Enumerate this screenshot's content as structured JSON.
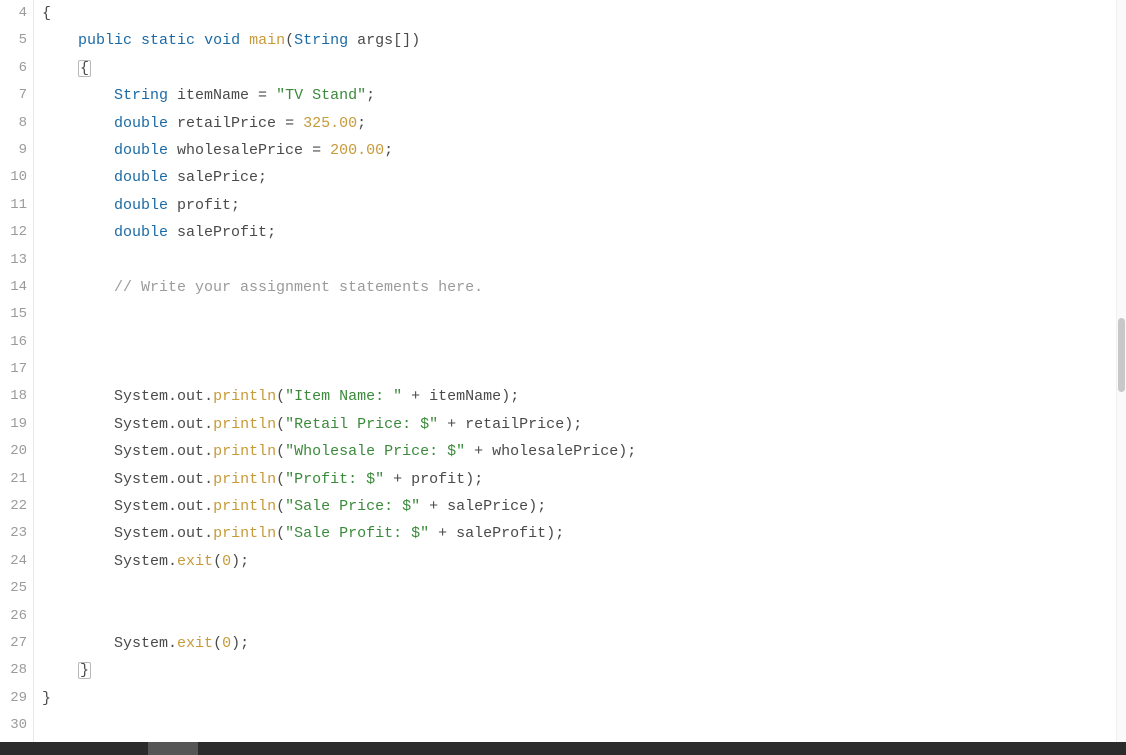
{
  "editor": {
    "first_line_number": 4,
    "line_count": 27,
    "lines": {
      "l4": [
        {
          "c": "tok-punct",
          "t": "{"
        }
      ],
      "l5": [
        {
          "c": "tok-ident",
          "t": "    "
        },
        {
          "c": "tok-keyword",
          "t": "public"
        },
        {
          "c": "tok-ident",
          "t": " "
        },
        {
          "c": "tok-keyword",
          "t": "static"
        },
        {
          "c": "tok-ident",
          "t": " "
        },
        {
          "c": "tok-keyword",
          "t": "void"
        },
        {
          "c": "tok-ident",
          "t": " "
        },
        {
          "c": "tok-func",
          "t": "main"
        },
        {
          "c": "tok-paren",
          "t": "("
        },
        {
          "c": "tok-class",
          "t": "String"
        },
        {
          "c": "tok-ident",
          "t": " args"
        },
        {
          "c": "tok-punct",
          "t": "[]"
        },
        {
          "c": "tok-paren",
          "t": ")"
        }
      ],
      "l6": [
        {
          "c": "tok-ident",
          "t": "    "
        },
        {
          "c": "tok-punct brace-hi",
          "t": "{"
        }
      ],
      "l7": [
        {
          "c": "tok-ident",
          "t": "        "
        },
        {
          "c": "tok-class",
          "t": "String"
        },
        {
          "c": "tok-ident",
          "t": " itemName "
        },
        {
          "c": "tok-op",
          "t": "="
        },
        {
          "c": "tok-ident",
          "t": " "
        },
        {
          "c": "tok-string",
          "t": "\"TV Stand\""
        },
        {
          "c": "tok-punct",
          "t": ";"
        }
      ],
      "l8": [
        {
          "c": "tok-ident",
          "t": "        "
        },
        {
          "c": "tok-keyword",
          "t": "double"
        },
        {
          "c": "tok-ident",
          "t": " retailPrice "
        },
        {
          "c": "tok-op",
          "t": "="
        },
        {
          "c": "tok-ident",
          "t": " "
        },
        {
          "c": "tok-number",
          "t": "325.00"
        },
        {
          "c": "tok-punct",
          "t": ";"
        }
      ],
      "l9": [
        {
          "c": "tok-ident",
          "t": "        "
        },
        {
          "c": "tok-keyword",
          "t": "double"
        },
        {
          "c": "tok-ident",
          "t": " wholesalePrice "
        },
        {
          "c": "tok-op",
          "t": "="
        },
        {
          "c": "tok-ident",
          "t": " "
        },
        {
          "c": "tok-number",
          "t": "200.00"
        },
        {
          "c": "tok-punct",
          "t": ";"
        }
      ],
      "l10": [
        {
          "c": "tok-ident",
          "t": "        "
        },
        {
          "c": "tok-keyword",
          "t": "double"
        },
        {
          "c": "tok-ident",
          "t": " salePrice"
        },
        {
          "c": "tok-punct",
          "t": ";"
        }
      ],
      "l11": [
        {
          "c": "tok-ident",
          "t": "        "
        },
        {
          "c": "tok-keyword",
          "t": "double"
        },
        {
          "c": "tok-ident",
          "t": " profit"
        },
        {
          "c": "tok-punct",
          "t": ";"
        }
      ],
      "l12": [
        {
          "c": "tok-ident",
          "t": "        "
        },
        {
          "c": "tok-keyword",
          "t": "double"
        },
        {
          "c": "tok-ident",
          "t": " saleProfit"
        },
        {
          "c": "tok-punct",
          "t": ";"
        }
      ],
      "l13": [
        {
          "c": "tok-ident",
          "t": ""
        }
      ],
      "l14": [
        {
          "c": "tok-ident",
          "t": "        "
        },
        {
          "c": "tok-comment",
          "t": "// Write your assignment statements here."
        }
      ],
      "l15": [
        {
          "c": "tok-ident",
          "t": ""
        }
      ],
      "l16": [
        {
          "c": "tok-ident",
          "t": ""
        }
      ],
      "l17": [
        {
          "c": "tok-ident",
          "t": ""
        }
      ],
      "l18": [
        {
          "c": "tok-ident",
          "t": "        System"
        },
        {
          "c": "tok-punct",
          "t": "."
        },
        {
          "c": "tok-ident",
          "t": "out"
        },
        {
          "c": "tok-punct",
          "t": "."
        },
        {
          "c": "tok-func",
          "t": "println"
        },
        {
          "c": "tok-paren",
          "t": "("
        },
        {
          "c": "tok-string",
          "t": "\"Item Name: \""
        },
        {
          "c": "tok-ident",
          "t": " "
        },
        {
          "c": "tok-op",
          "t": "+"
        },
        {
          "c": "tok-ident",
          "t": " itemName"
        },
        {
          "c": "tok-paren",
          "t": ")"
        },
        {
          "c": "tok-punct",
          "t": ";"
        }
      ],
      "l19": [
        {
          "c": "tok-ident",
          "t": "        System"
        },
        {
          "c": "tok-punct",
          "t": "."
        },
        {
          "c": "tok-ident",
          "t": "out"
        },
        {
          "c": "tok-punct",
          "t": "."
        },
        {
          "c": "tok-func",
          "t": "println"
        },
        {
          "c": "tok-paren",
          "t": "("
        },
        {
          "c": "tok-string",
          "t": "\"Retail Price: $\""
        },
        {
          "c": "tok-ident",
          "t": " "
        },
        {
          "c": "tok-op",
          "t": "+"
        },
        {
          "c": "tok-ident",
          "t": " retailPrice"
        },
        {
          "c": "tok-paren",
          "t": ")"
        },
        {
          "c": "tok-punct",
          "t": ";"
        }
      ],
      "l20": [
        {
          "c": "tok-ident",
          "t": "        System"
        },
        {
          "c": "tok-punct",
          "t": "."
        },
        {
          "c": "tok-ident",
          "t": "out"
        },
        {
          "c": "tok-punct",
          "t": "."
        },
        {
          "c": "tok-func",
          "t": "println"
        },
        {
          "c": "tok-paren",
          "t": "("
        },
        {
          "c": "tok-string",
          "t": "\"Wholesale Price: $\""
        },
        {
          "c": "tok-ident",
          "t": " "
        },
        {
          "c": "tok-op",
          "t": "+"
        },
        {
          "c": "tok-ident",
          "t": " wholesalePrice"
        },
        {
          "c": "tok-paren",
          "t": ")"
        },
        {
          "c": "tok-punct",
          "t": ";"
        }
      ],
      "l21": [
        {
          "c": "tok-ident",
          "t": "        System"
        },
        {
          "c": "tok-punct",
          "t": "."
        },
        {
          "c": "tok-ident",
          "t": "out"
        },
        {
          "c": "tok-punct",
          "t": "."
        },
        {
          "c": "tok-func",
          "t": "println"
        },
        {
          "c": "tok-paren",
          "t": "("
        },
        {
          "c": "tok-string",
          "t": "\"Profit: $\""
        },
        {
          "c": "tok-ident",
          "t": " "
        },
        {
          "c": "tok-op",
          "t": "+"
        },
        {
          "c": "tok-ident",
          "t": " profit"
        },
        {
          "c": "tok-paren",
          "t": ")"
        },
        {
          "c": "tok-punct",
          "t": ";"
        }
      ],
      "l22": [
        {
          "c": "tok-ident",
          "t": "        System"
        },
        {
          "c": "tok-punct",
          "t": "."
        },
        {
          "c": "tok-ident",
          "t": "out"
        },
        {
          "c": "tok-punct",
          "t": "."
        },
        {
          "c": "tok-func",
          "t": "println"
        },
        {
          "c": "tok-paren",
          "t": "("
        },
        {
          "c": "tok-string",
          "t": "\"Sale Price: $\""
        },
        {
          "c": "tok-ident",
          "t": " "
        },
        {
          "c": "tok-op",
          "t": "+"
        },
        {
          "c": "tok-ident",
          "t": " salePrice"
        },
        {
          "c": "tok-paren",
          "t": ")"
        },
        {
          "c": "tok-punct",
          "t": ";"
        }
      ],
      "l23": [
        {
          "c": "tok-ident",
          "t": "        System"
        },
        {
          "c": "tok-punct",
          "t": "."
        },
        {
          "c": "tok-ident",
          "t": "out"
        },
        {
          "c": "tok-punct",
          "t": "."
        },
        {
          "c": "tok-func",
          "t": "println"
        },
        {
          "c": "tok-paren",
          "t": "("
        },
        {
          "c": "tok-string",
          "t": "\"Sale Profit: $\""
        },
        {
          "c": "tok-ident",
          "t": " "
        },
        {
          "c": "tok-op",
          "t": "+"
        },
        {
          "c": "tok-ident",
          "t": " saleProfit"
        },
        {
          "c": "tok-paren",
          "t": ")"
        },
        {
          "c": "tok-punct",
          "t": ";"
        }
      ],
      "l24": [
        {
          "c": "tok-ident",
          "t": "        System"
        },
        {
          "c": "tok-punct",
          "t": "."
        },
        {
          "c": "tok-func",
          "t": "exit"
        },
        {
          "c": "tok-paren",
          "t": "("
        },
        {
          "c": "tok-number",
          "t": "0"
        },
        {
          "c": "tok-paren",
          "t": ")"
        },
        {
          "c": "tok-punct",
          "t": ";"
        }
      ],
      "l25": [
        {
          "c": "tok-ident",
          "t": ""
        }
      ],
      "l26": [
        {
          "c": "tok-ident",
          "t": ""
        }
      ],
      "l27": [
        {
          "c": "tok-ident",
          "t": "        System"
        },
        {
          "c": "tok-punct",
          "t": "."
        },
        {
          "c": "tok-func",
          "t": "exit"
        },
        {
          "c": "tok-paren",
          "t": "("
        },
        {
          "c": "tok-number",
          "t": "0"
        },
        {
          "c": "tok-paren",
          "t": ")"
        },
        {
          "c": "tok-punct",
          "t": ";"
        }
      ],
      "l28": [
        {
          "c": "tok-ident",
          "t": "    "
        },
        {
          "c": "tok-punct brace-hi",
          "t": "}"
        }
      ],
      "l29": [
        {
          "c": "tok-punct",
          "t": "}"
        }
      ],
      "l30": [
        {
          "c": "tok-ident",
          "t": ""
        }
      ]
    }
  }
}
